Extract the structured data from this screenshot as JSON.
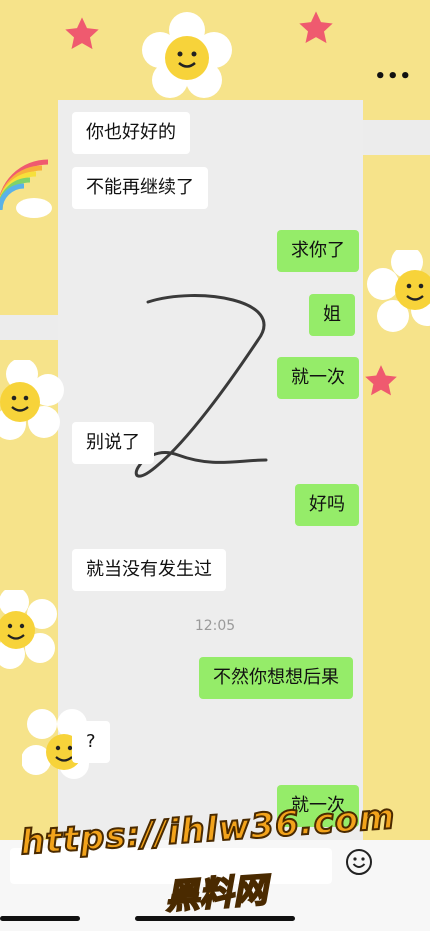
{
  "header": {
    "menu_icon": "more-dots-icon"
  },
  "messages": [
    {
      "side": "left",
      "text": "你也好好的"
    },
    {
      "side": "left",
      "text": "不能再继续了"
    },
    {
      "side": "right",
      "text": "求你了"
    },
    {
      "side": "right",
      "text": "姐"
    },
    {
      "side": "right",
      "text": "就一次"
    },
    {
      "side": "left",
      "text": "别说了"
    },
    {
      "side": "right",
      "text": "好吗"
    },
    {
      "side": "left",
      "text": "就当没有发生过"
    },
    {
      "side": "right",
      "text": "不然你想想后果"
    },
    {
      "side": "left",
      "text": "?"
    },
    {
      "side": "right",
      "text": "就一次"
    }
  ],
  "timestamp": "12:05",
  "input": {
    "emoji_icon": "emoji-icon"
  },
  "watermark": {
    "url": "https://ihlw36.com",
    "site_name": "黑料网"
  },
  "colors": {
    "own_bubble": "#95ec69",
    "other_bubble": "#ffffff",
    "background": "#ededed",
    "decor_yellow": "#f6e38a"
  }
}
